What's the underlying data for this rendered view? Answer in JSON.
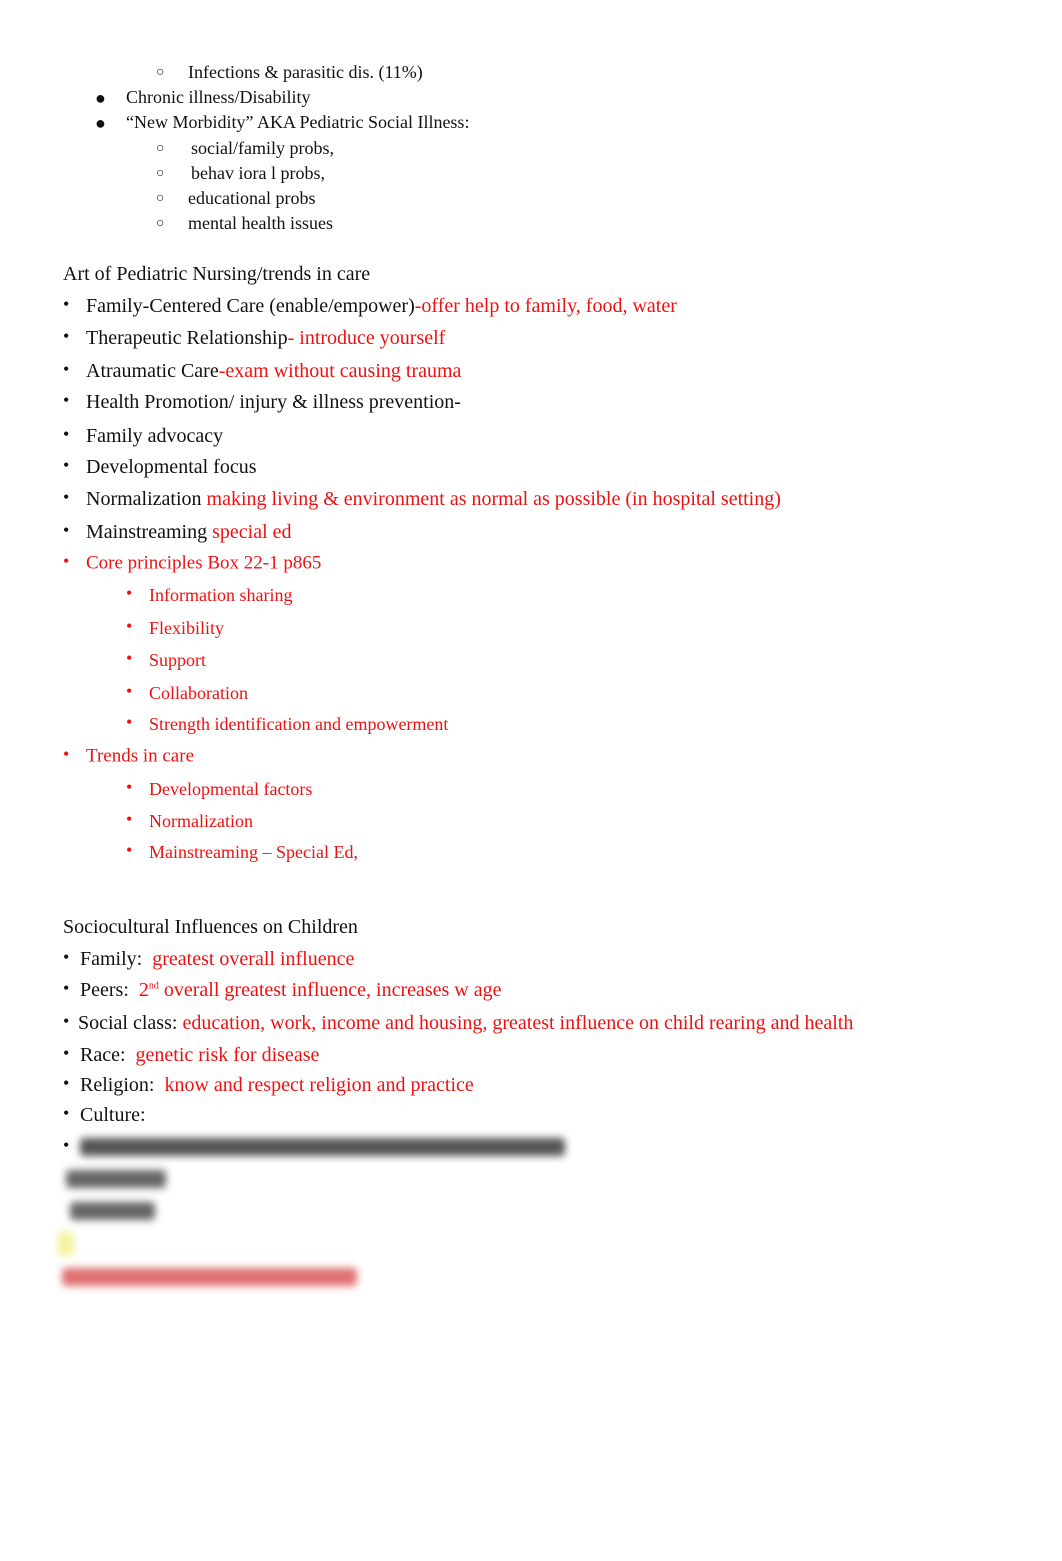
{
  "top_list": {
    "sub1": "Infections & parasitic dis. (11%)",
    "items": [
      "Chronic illness/Disability",
      "“New Morbidity” AKA Pediatric Social Illness:"
    ],
    "sub2": [
      "social/family probs,",
      "behav iora l probs,",
      "educational probs",
      "mental health issues"
    ]
  },
  "art": {
    "heading": "Art of Pediatric Nursing/trends in care",
    "items": [
      {
        "black": "Family-Centered Care (enable/empower)",
        "red": "-offer help to family, food, water"
      },
      {
        "black": "Therapeutic Relationship",
        "red": "- introduce yourself"
      },
      {
        "black": "Atraumatic Care",
        "red": "-exam without causing trauma"
      },
      {
        "black": "Health Promotion/ injury & illness prevention-",
        "red": ""
      },
      {
        "black": "Family advocacy",
        "red": ""
      },
      {
        "black": "Developmental focus",
        "red": ""
      },
      {
        "black": "Normalization ",
        "red": "making living & environment as normal as possible (in hospital setting)"
      },
      {
        "black": "Mainstreaming ",
        "red": "special ed"
      }
    ],
    "core": {
      "label": "Core principles Box 22-1 p865",
      "items": [
        "Information sharing",
        "Flexibility",
        "Support",
        "Collaboration",
        "Strength identification and empowerment"
      ]
    },
    "trends": {
      "label": "Trends in care",
      "items": [
        "Developmental factors",
        "Normalization",
        "Mainstreaming – Special Ed,"
      ]
    }
  },
  "socio": {
    "heading": "Sociocultural Influences on Children",
    "items": [
      {
        "black": "Family:",
        "red": "greatest overall influence"
      },
      {
        "black": "Peers:",
        "red_pre": "2",
        "sup": "nd",
        "red": " overall greatest influence, increases w age"
      },
      {
        "black": "Social class:",
        "red": "education, work, income and housing, greatest influence on child rearing and health"
      },
      {
        "black": "Race:",
        "red": "genetic risk for disease"
      },
      {
        "black": "Religion:",
        "red": "know and respect religion and practice"
      },
      {
        "black": "Culture:",
        "red": ""
      }
    ]
  },
  "colors": {
    "accent_red": "#ee1111",
    "text": "#111111"
  }
}
